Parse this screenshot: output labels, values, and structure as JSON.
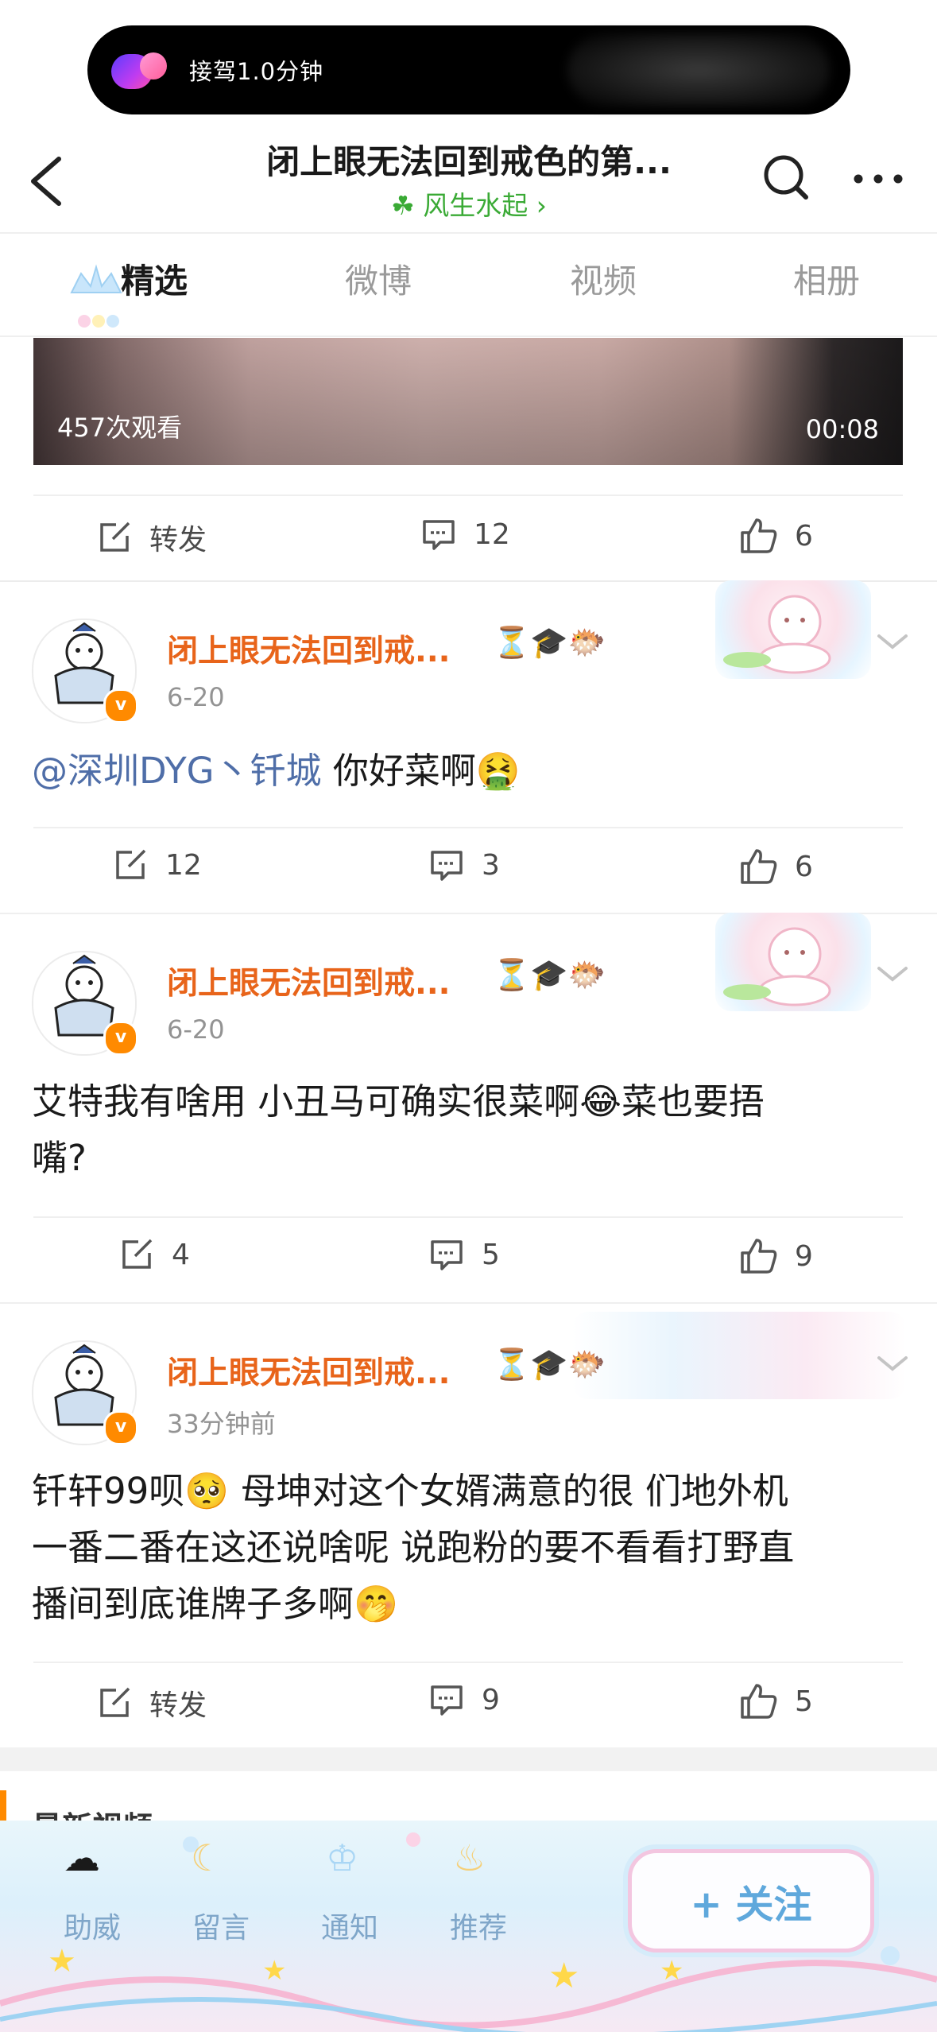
{
  "status": {
    "call_label": "接驾1.0分钟"
  },
  "nav": {
    "title": "闭上眼无法回到戒色的第...",
    "subtitle": "风生水起 ›"
  },
  "tabs": [
    {
      "label": "精选",
      "active": true
    },
    {
      "label": "微博",
      "active": false
    },
    {
      "label": "视频",
      "active": false
    },
    {
      "label": "相册",
      "active": false
    }
  ],
  "video": {
    "views": "457次观看",
    "duration": "00:08"
  },
  "first_actions": {
    "repost": "转发",
    "comments": "12",
    "likes": "6"
  },
  "posts": [
    {
      "username": "闭上眼无法回到戒...",
      "badges": [
        "hourglass-icon",
        "graduation-cap-icon",
        "pufferfish-icon"
      ],
      "time": "6-20",
      "mention": "@深圳DYG丶钎城",
      "text": " 你好菜啊",
      "repost": "12",
      "comments": "3",
      "likes": "6"
    },
    {
      "username": "闭上眼无法回到戒...",
      "badges": [
        "hourglass-icon",
        "graduation-cap-icon",
        "pufferfish-icon"
      ],
      "time": "6-20",
      "text_line1": "艾特我有啥用 小丑马可确实很菜啊",
      "text_line1b": "菜也要捂",
      "text_line2": "嘴?",
      "repost": "4",
      "comments": "5",
      "likes": "9"
    },
    {
      "username": "闭上眼无法回到戒...",
      "badges": [
        "hourglass-icon",
        "graduation-cap-icon",
        "pufferfish-icon"
      ],
      "time": "33分钟前",
      "text_line1a": "钎轩99呗",
      "text_line1b": " 母坤对这个女婿满意的很 们地外机",
      "text_line2": "一番二番在这还说啥呢 说跑粉的要不看看打野直",
      "text_line3": "播间到底谁牌子多啊",
      "repost": "转发",
      "comments": "9",
      "likes": "5"
    }
  ],
  "section": {
    "latest_video": "最新视频"
  },
  "bottom_bar": {
    "items": [
      "助威",
      "留言",
      "通知",
      "推荐"
    ],
    "follow": "+ 关注"
  },
  "colors": {
    "username": "#e8641a",
    "verified": "#ff8a00",
    "mention": "#4f6ea8",
    "subtitle": "#3aaa35"
  }
}
